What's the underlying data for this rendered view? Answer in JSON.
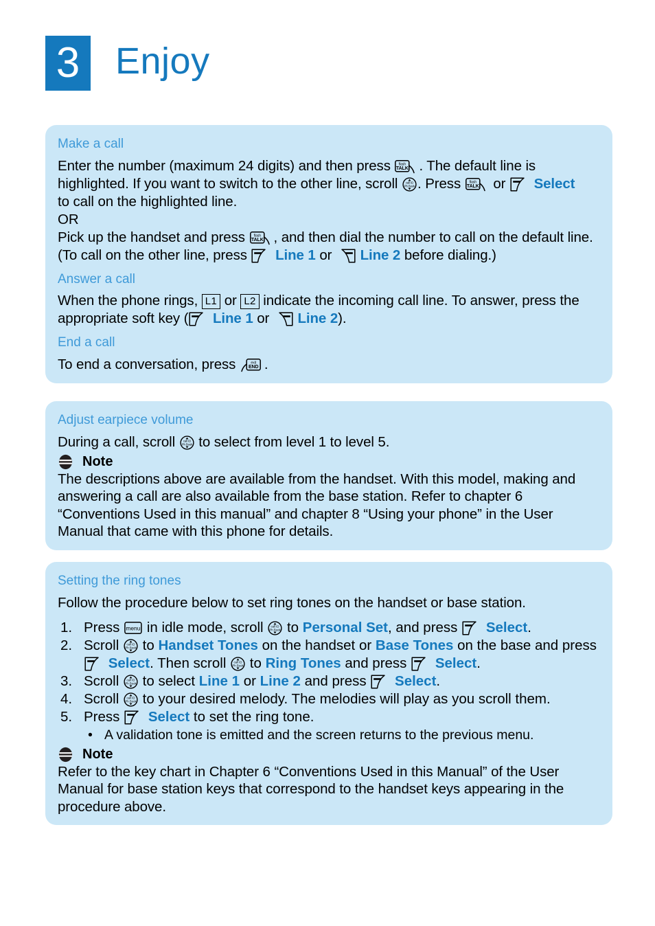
{
  "header": {
    "chapter_number": "3",
    "title": "Enjoy",
    "badge_color": "#1579bd",
    "title_color": "#1579bd"
  },
  "theme": {
    "panel_bg": "#cbe7f7",
    "heading_blue": "#3f9ad8",
    "accent_blue": "#1579bd",
    "body_text": "#000000"
  },
  "icons": {
    "talk_key": {
      "name": "talk-key-icon",
      "top_label": "flash",
      "main_label": "TALK"
    },
    "end_key": {
      "name": "end-key-icon",
      "top_label": "exit",
      "main_label": "END"
    },
    "menu_key": {
      "name": "menu-key-icon",
      "label": "menu"
    },
    "scroll_key": {
      "name": "scroll-navigation-key-icon",
      "top_label": "call ID",
      "bottom_label": "Ph Book"
    },
    "left_soft_key": {
      "name": "left-soft-key-icon"
    },
    "right_soft_key": {
      "name": "right-soft-key-icon"
    },
    "note": {
      "name": "note-icon"
    }
  },
  "panels": {
    "calls": {
      "sections": [
        {
          "heading": "Make a call"
        },
        {
          "heading": "Answer a call"
        },
        {
          "heading": "End a call"
        }
      ],
      "make_a_call": {
        "t1": "Enter the number (maximum 24 digits) and then press",
        "t2": ". The default line is",
        "t3": "highlighted. If you want to switch to the other line, scroll",
        "t4": ". Press",
        "t5": "or",
        "select": "Select",
        "t6": "to call on the highlighted line.",
        "or": "OR",
        "t7": "Pick up the handset and press",
        "t8": ", and then dial the number to call on the default line.",
        "t9": "(To call on the other line, press",
        "line1": "Line 1",
        "t10": "or",
        "line2": "Line 2",
        "t11": "before dialing.)"
      },
      "answer_a_call": {
        "t1": "When the phone rings,",
        "l1": "L1",
        "t2": "or",
        "l2": "L2",
        "t3": "indicate the incoming call line. To answer, press the",
        "t4": "appropriate soft key (",
        "line1": "Line 1",
        "t5": "or",
        "line2": "Line 2",
        "t6": ")."
      },
      "end_a_call": {
        "t1": "To end a conversation, press",
        "t2": "."
      }
    },
    "volume": {
      "heading": "Adjust earpiece volume",
      "t1": "During a call, scroll",
      "t2": "to select from level 1 to level 5.",
      "note_label": "Note",
      "note_body": "The descriptions above are available from the handset. With this model, making and answering a call are also available from the base station. Refer to chapter 6 “Conventions Used in this manual” and chapter 8 “Using your phone” in the User Manual that came with this phone for details."
    },
    "ringtones": {
      "heading": "Setting the ring tones",
      "intro": "Follow the procedure below to set ring tones on the handset or base station.",
      "steps": [
        {
          "num": "1.",
          "t1": "Press",
          "t2": "in idle mode, scroll",
          "t3": "to",
          "b1": "Personal Set",
          "t4": ", and press",
          "b2": "Select",
          "t5": "."
        },
        {
          "num": "2.",
          "t1": "Scroll",
          "t2": "to",
          "b1": "Handset Tones",
          "t3": "on the handset or",
          "b2": "Base Tones",
          "t4": "on the base and press",
          "b3": "Select",
          "t5": ". Then scroll",
          "t6": "to",
          "b4": "Ring Tones",
          "t7": "and press",
          "b5": "Select",
          "t8": "."
        },
        {
          "num": "3.",
          "t1": "Scroll",
          "t2": "to select",
          "b1": "Line 1",
          "t3": "or",
          "b2": "Line 2",
          "t4": "and press",
          "b3": "Select",
          "t5": "."
        },
        {
          "num": "4.",
          "t1": "Scroll",
          "t2": "to your desired melody. The melodies will play as you scroll them."
        },
        {
          "num": "5.",
          "t1": "Press",
          "b1": "Select",
          "t2": "to set the ring tone.",
          "sub_bullet": "•",
          "sub_text": "A validation tone is emitted and the screen returns to the previous menu."
        }
      ],
      "note_label": "Note",
      "note_body": "Refer to the key chart in Chapter 6 “Conventions Used in this Manual” of the User Manual for base station keys that correspond to the handset keys appearing in the procedure above."
    }
  }
}
